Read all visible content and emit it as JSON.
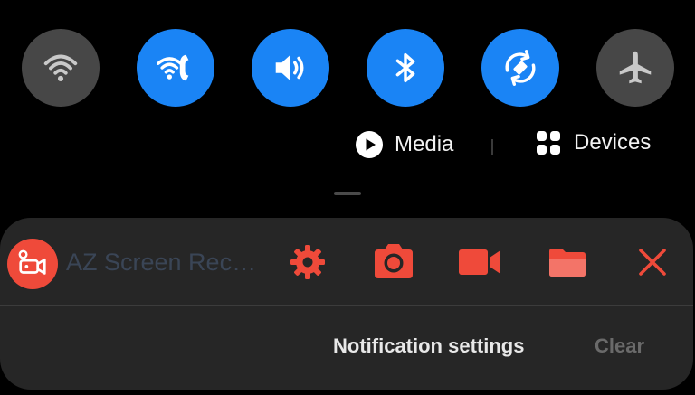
{
  "quick_settings": {
    "toggles": [
      {
        "id": "wifi",
        "icon": "wifi-icon",
        "state": "off"
      },
      {
        "id": "wifi-calling",
        "icon": "wifi-calling-icon",
        "state": "on"
      },
      {
        "id": "sound",
        "icon": "sound-icon",
        "state": "on"
      },
      {
        "id": "bluetooth",
        "icon": "bluetooth-icon",
        "state": "on"
      },
      {
        "id": "auto-rotate",
        "icon": "auto-rotate-icon",
        "state": "on"
      },
      {
        "id": "airplane-mode",
        "icon": "airplane-icon",
        "state": "off"
      }
    ],
    "media_label": "Media",
    "devices_label": "Devices"
  },
  "notification": {
    "app_name": "AZ Screen Rec…",
    "actions": [
      {
        "icon": "gear-icon"
      },
      {
        "icon": "camera-icon"
      },
      {
        "icon": "video-camera-icon"
      },
      {
        "icon": "folder-icon"
      },
      {
        "icon": "close-icon"
      }
    ]
  },
  "footer": {
    "settings_label": "Notification settings",
    "clear_label": "Clear"
  },
  "colors": {
    "background": "#000000",
    "toggle_on": "#1a84f5",
    "toggle_off": "#474747",
    "panel": "#262626",
    "accent_red": "#ef4a3a",
    "muted_text": "#6a6a6a",
    "app_name_text": "#3a4556"
  }
}
